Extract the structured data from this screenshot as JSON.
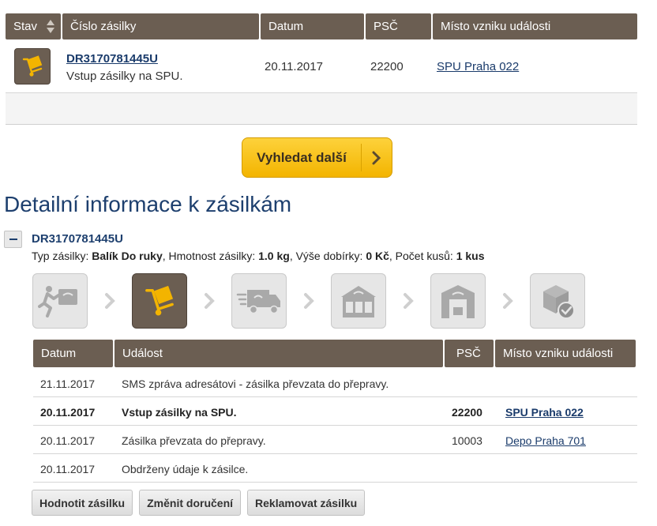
{
  "results_table": {
    "columns": [
      "Stav",
      "Číslo zásilky",
      "Datum",
      "PSČ",
      "Místo vzniku události"
    ],
    "row": {
      "status_icon": "parcel-trolley-icon",
      "tracking_number": "DR3170781445U",
      "description": "Vstup zásilky na SPU.",
      "date": "20.11.2017",
      "psc": "22200",
      "place": "SPU Praha 022"
    }
  },
  "search_more": {
    "label": "Vyhledat další"
  },
  "detail": {
    "title": "Detailní informace k zásilkám",
    "tracking_number": "DR3170781445U",
    "meta": {
      "type_label": "Typ zásilky:",
      "type_value": "Balík Do ruky",
      "weight_label": "Hmotnost zásilky:",
      "weight_value": "1.0 kg",
      "cod_label": "Výše dobírky:",
      "cod_value": "0 Kč",
      "pieces_label": "Počet kusů:",
      "pieces_value": "1 kus"
    },
    "steps": [
      {
        "icon": "courier-running-icon",
        "active": false
      },
      {
        "icon": "parcel-trolley-icon",
        "active": true
      },
      {
        "icon": "delivery-truck-icon",
        "active": false
      },
      {
        "icon": "post-office-icon",
        "active": false
      },
      {
        "icon": "depot-building-icon",
        "active": false
      },
      {
        "icon": "parcel-delivered-icon",
        "active": false
      }
    ],
    "events_columns": [
      "Datum",
      "Událost",
      "PSČ",
      "Místo vzniku události"
    ],
    "events": [
      {
        "date": "21.11.2017",
        "event": "SMS zpráva adresátovi - zásilka převzata do přepravy.",
        "psc": "",
        "place": "",
        "bold": false
      },
      {
        "date": "20.11.2017",
        "event": "Vstup zásilky na SPU.",
        "psc": "22200",
        "place": "SPU Praha 022",
        "bold": true
      },
      {
        "date": "20.11.2017",
        "event": "Zásilka převzata do přepravy.",
        "psc": "10003",
        "place": "Depo Praha 701",
        "bold": false
      },
      {
        "date": "20.11.2017",
        "event": "Obdrženy údaje k zásilce.",
        "psc": "",
        "place": "",
        "bold": false
      }
    ]
  },
  "actions": {
    "rate": "Hodnotit zásilku",
    "change_delivery": "Změnit doručení",
    "complain": "Reklamovat zásilku"
  },
  "colors": {
    "header_brown": "#6b5e52",
    "accent_yellow": "#f5be14",
    "link_blue": "#1a3b6b"
  }
}
